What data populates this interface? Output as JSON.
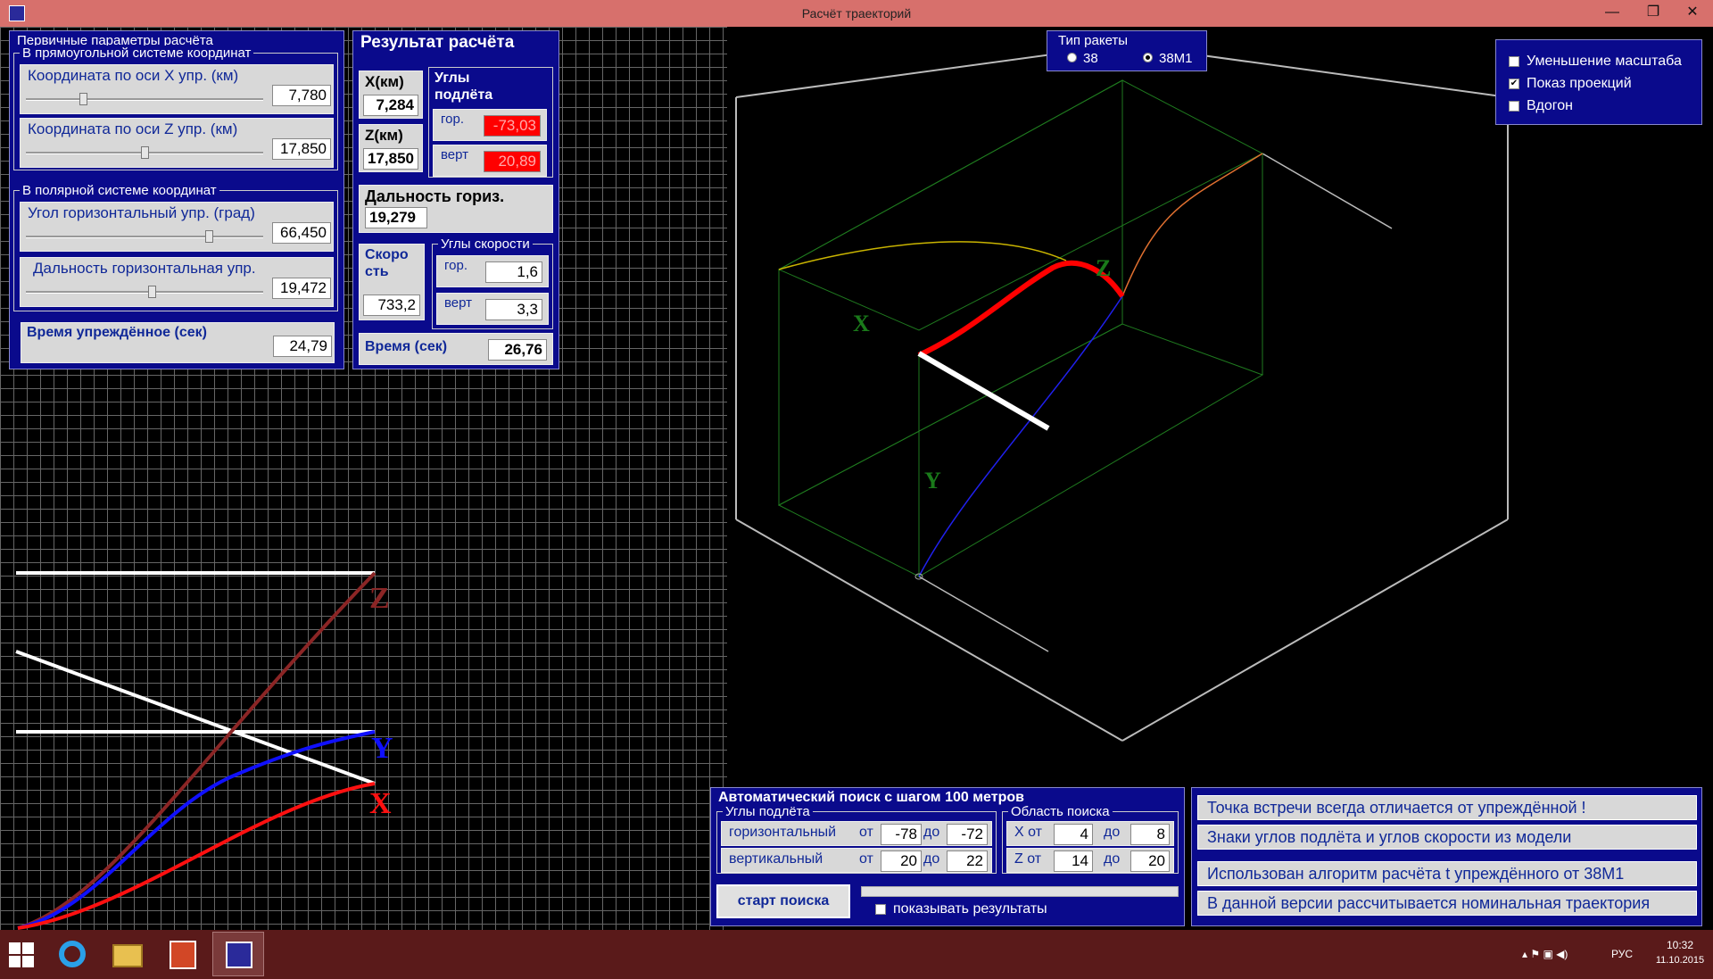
{
  "window": {
    "title": "Расчёт траекторий",
    "minimize_glyph": "—",
    "maximize_glyph": "❐",
    "close_glyph": "✕"
  },
  "primary_params": {
    "title": "Первичные параметры расчёта",
    "rect_group": "В прямоугольной системе координат",
    "x_label": "Координата по оси X упр. (км)",
    "x_value": "7,780",
    "x_level": 0.24,
    "z_label": "Координата по оси Z упр. (км)",
    "z_value": "17,850",
    "z_level": 0.5,
    "polar_group": "В полярной системе координат",
    "angle_label": "Угол горизонтальный упр. (град)",
    "angle_value": "66,450",
    "angle_level": 0.77,
    "range_label": "Дальность горизонтальная упр.",
    "range_value": "19,472",
    "range_level": 0.53,
    "time_label": "Время упреждённое (сек)",
    "time_value": "24,79"
  },
  "result": {
    "title": "Результат расчёта",
    "x_label": "X(км)",
    "x_value": "7,284",
    "z_label": "Z(км)",
    "z_value": "17,850",
    "launch_angles_label": "Углы подлёта",
    "hor_label": "гор.",
    "hor_value": "-73,03",
    "vert_label": "верт",
    "vert_value": "20,89",
    "range_label": "Дальность гориз.",
    "range_value": "19,279",
    "speed_label": "Скоро сть",
    "speed_value": "733,2",
    "speed_angles_label": "Углы скорости",
    "speed_hor_label": "гор.",
    "speed_hor_value": "1,6",
    "speed_vert_label": "верт",
    "speed_vert_value": "3,3",
    "time_label": "Время (сек)",
    "time_value": "26,76"
  },
  "missile_type": {
    "title": "Тип ракеты",
    "option1": "38",
    "option2": "38М1",
    "selected": "38М1"
  },
  "view_options": {
    "scale_down": "Уменьшение масштаба",
    "scale_down_checked": false,
    "show_projections": "Показ проекций",
    "show_projections_checked": true,
    "chase": "Вдогон",
    "chase_checked": false,
    "check_glyph": "✔"
  },
  "auto_search": {
    "title": "Автоматический поиск с шагом 100 метров",
    "angles_group": "Углы подлёта",
    "horizontal_label": "горизонтальный",
    "horizontal_from_label": "от",
    "horizontal_from": "-78",
    "horizontal_to_label": "до",
    "horizontal_to": "-72",
    "vertical_label": "вертикальный",
    "vertical_from_label": "от",
    "vertical_from": "20",
    "vertical_to_label": "до",
    "vertical_to": "22",
    "area_group": "Область поиска",
    "x_from_label": "X от",
    "x_from": "4",
    "x_to_label": "до",
    "x_to": "8",
    "z_from_label": "Z от",
    "z_from": "14",
    "z_to_label": "до",
    "z_to": "20",
    "start_button": "старт поиска",
    "show_results": "показывать результаты",
    "show_results_checked": false
  },
  "notes": [
    "Точка встречи всегда отличается от упреждённой !",
    "Знаки углов подлёта и углов скорости из модели",
    "Использован алгоритм расчёта t упреждённого от 38М1",
    "В данной версии рассчитывается номинальная траектория"
  ],
  "axis_labels": {
    "z": "Z",
    "y": "Y",
    "x": "X"
  },
  "colors": {
    "panel": "#0a0a8c",
    "title_bar": "#d7706c",
    "taskbar": "#5a1a1a",
    "highlight_red": "#ff0000",
    "label_blue": "#102898",
    "axis_green": "#1a7a1a"
  },
  "taskbar": {
    "start_icon": "windows-logo-icon",
    "items": [
      "internet-explorer-icon",
      "file-explorer-icon",
      "powerpoint-icon",
      "trajectory-app-icon"
    ],
    "language": "РУС",
    "time": "10:32",
    "date": "11.10.2015"
  }
}
